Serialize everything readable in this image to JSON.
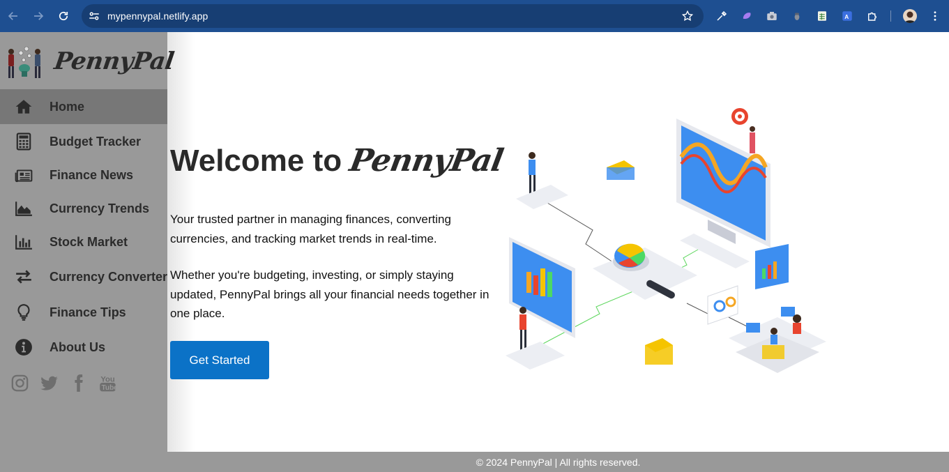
{
  "browser": {
    "url": "mypennypal.netlify.app"
  },
  "sidebar": {
    "logo_text": "PennyPal",
    "items": [
      {
        "label": "Home",
        "icon": "home-icon",
        "active": true
      },
      {
        "label": "Budget Tracker",
        "icon": "calculator-icon",
        "active": false
      },
      {
        "label": "Finance News",
        "icon": "newspaper-icon",
        "active": false
      },
      {
        "label": "Currency Trends",
        "icon": "area-chart-icon",
        "active": false
      },
      {
        "label": "Stock Market",
        "icon": "bar-chart-icon",
        "active": false
      },
      {
        "label": "Currency Converter",
        "icon": "exchange-icon",
        "active": false
      },
      {
        "label": "Finance Tips",
        "icon": "lightbulb-icon",
        "active": false
      },
      {
        "label": "About Us",
        "icon": "info-icon",
        "active": false
      }
    ],
    "socials": [
      "instagram-icon",
      "twitter-icon",
      "facebook-icon",
      "youtube-icon"
    ]
  },
  "hero": {
    "title_prefix": "Welcome to",
    "title_brand": "PennyPal",
    "paragraph_1": "Your trusted partner in managing finances, converting currencies, and tracking market trends in real-time.",
    "paragraph_2": "Whether you're budgeting, investing, or simply staying updated, PennyPal brings all your financial needs together in one place.",
    "cta_label": "Get Started"
  },
  "footer": {
    "text": "© 2024 PennyPal | All rights reserved."
  },
  "colors": {
    "chrome": "#1e4f91",
    "sidebar": "#999999",
    "sidebar_active": "#777777",
    "cta": "#0b72c7"
  }
}
